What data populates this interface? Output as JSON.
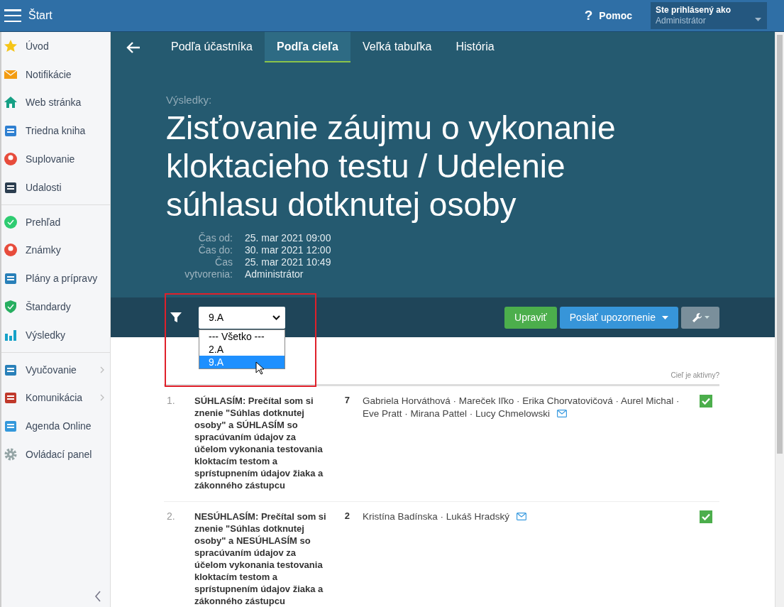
{
  "top_bar": {
    "title": "Štart",
    "help_icon": "?",
    "help": "Pomoc",
    "user_label": "Ste prihlásený ako",
    "user_name": "Administrátor"
  },
  "sidebar": {
    "groups": [
      [
        {
          "label": "Úvod",
          "expandable": false
        },
        {
          "label": "Notifikácie",
          "expandable": false
        },
        {
          "label": "Web stránka",
          "expandable": false
        },
        {
          "label": "Triedna kniha",
          "expandable": false
        },
        {
          "label": "Suplovanie",
          "expandable": false
        },
        {
          "label": "Udalosti",
          "expandable": false
        }
      ],
      [
        {
          "label": "Prehľad",
          "expandable": false
        },
        {
          "label": "Známky",
          "expandable": false
        },
        {
          "label": "Plány a prípravy",
          "expandable": false
        },
        {
          "label": "Štandardy",
          "expandable": false
        },
        {
          "label": "Výsledky",
          "expandable": false
        }
      ],
      [
        {
          "label": "Vyučovanie",
          "expandable": true
        },
        {
          "label": "Komunikácia",
          "expandable": true
        },
        {
          "label": "Agenda Online",
          "expandable": false
        },
        {
          "label": "Ovládací panel",
          "expandable": false
        }
      ]
    ]
  },
  "tabs": [
    {
      "label": "Podľa účastníka",
      "selected": false
    },
    {
      "label": "Podľa cieľa",
      "selected": true
    },
    {
      "label": "Veľká tabuľka",
      "selected": false
    },
    {
      "label": "História",
      "selected": false
    }
  ],
  "header": {
    "kicker": "Výsledky:",
    "title": "Zisťovanie záujmu o vykonanie kloktacieho testu / Udelenie súhlasu dotknutej osoby",
    "meta": [
      {
        "label": "Čas od:",
        "value": "25. mar 2021 09:00"
      },
      {
        "label": "Čas do:",
        "value": "30. mar 2021 12:00"
      },
      {
        "label": "Čas vytvorenia:",
        "value": "25. mar 2021 10:49",
        "value2": "Administrátor"
      }
    ]
  },
  "filter": {
    "value": "9.A",
    "options": [
      {
        "label": "--- Všetko ---",
        "selected": false
      },
      {
        "label": "2.A",
        "selected": false
      },
      {
        "label": "9.A",
        "selected": true
      }
    ]
  },
  "buttons": {
    "edit": "Upraviť",
    "notify": "Poslať upozornenie"
  },
  "active_header": "Cieľ je aktívny?",
  "rows": [
    {
      "number": "1.",
      "text": "SÚHLASÍM: Prečítal som si znenie \"Súhlas dotknutej osoby\" a SÚHLASÍM so spracúvaním údajov za účelom vykonania testovania kloktacím testom a sprístupnením údajov žiaka a zákonného zástupcu",
      "count": "7",
      "names": "Gabriela Horváthová · Mareček Iľko · Erika Chorvatovičová · Aurel Michal · Eve Pratt · Mirana Pattel · Lucy Chmelowski",
      "active": true
    },
    {
      "number": "2.",
      "text": "NESÚHLASÍM: Prečítal som si znenie \"Súhlas dotknutej osoby\" a NESÚHLASÍM so spracúvaním údajov za účelom vykonania testovania kloktacím testom a sprístupnením údajov žiaka a zákonného zástupcu",
      "count": "2",
      "names": "Kristína Badínska · Lukáš Hradský",
      "active": true
    }
  ]
}
